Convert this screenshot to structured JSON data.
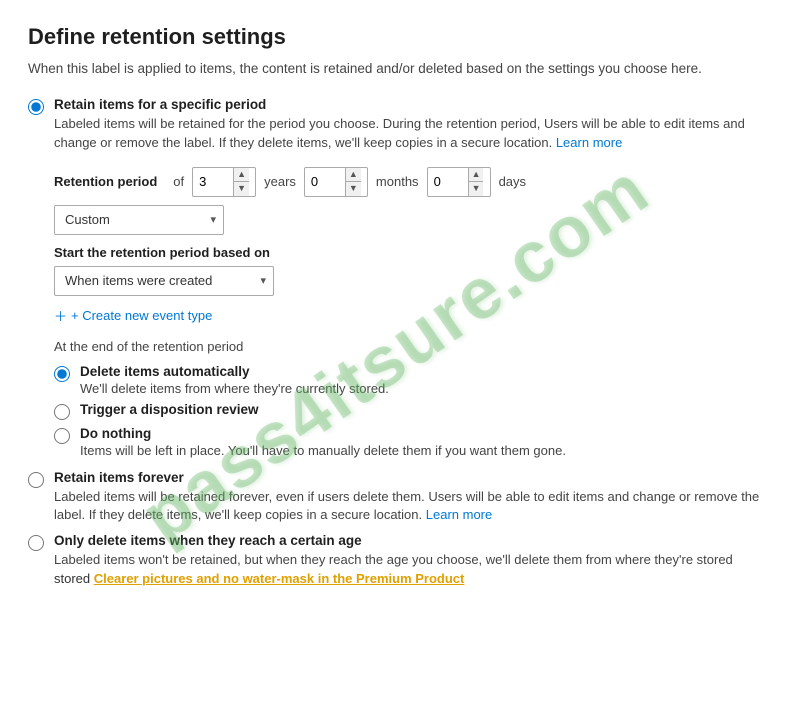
{
  "page": {
    "title": "Define retention settings",
    "subtitle": "When this label is applied to items, the content is retained and/or deleted based on the settings you choose here."
  },
  "options": {
    "retain_specific": {
      "label": "Retain items for a specific period",
      "description": "Labeled items will be retained for the period you choose. During the retention period, Users will be able to edit items and change or remove the label. If they delete items, we'll keep copies in a secure location.",
      "learn_more": "Learn more",
      "checked": true
    },
    "retention_period": {
      "label": "Retention period",
      "of": "of",
      "value1": "3",
      "unit1": "years",
      "value2": "0",
      "unit2": "months",
      "value3": "0",
      "unit3": "days",
      "dropdown_label": "Custom"
    },
    "start_period": {
      "label": "Start the retention period based on",
      "value": "When items were created"
    },
    "create_event": {
      "label": "+ Create new event type"
    },
    "end_period": {
      "label": "At the end of the retention period"
    },
    "delete_automatically": {
      "label": "Delete items automatically",
      "description": "We'll delete items from where they're currently stored.",
      "checked": true
    },
    "trigger_disposition": {
      "label": "Trigger a disposition review",
      "checked": false
    },
    "do_nothing": {
      "label": "Do nothing",
      "description": "Items will be left in place. You'll have to manually delete them if you want them gone.",
      "checked": false
    },
    "retain_forever": {
      "label": "Retain items forever",
      "description": "Labeled items will be retained forever, even if users delete them. Users will be able to edit items and change or remove the label. If they delete items, we'll keep copies in a secure location.",
      "learn_more": "Learn more",
      "checked": false
    },
    "only_delete": {
      "label": "Only delete items when they reach a certain age",
      "description": "Labeled items won't be retained, but when they reach the age you choose, we'll delete them from where they're stored",
      "checked": false
    }
  },
  "premium": {
    "text": "Clearer pictures and no water-mask in the Premium Product",
    "prefix": "stored "
  },
  "watermark": {
    "line1": "pass4itsure.com"
  }
}
